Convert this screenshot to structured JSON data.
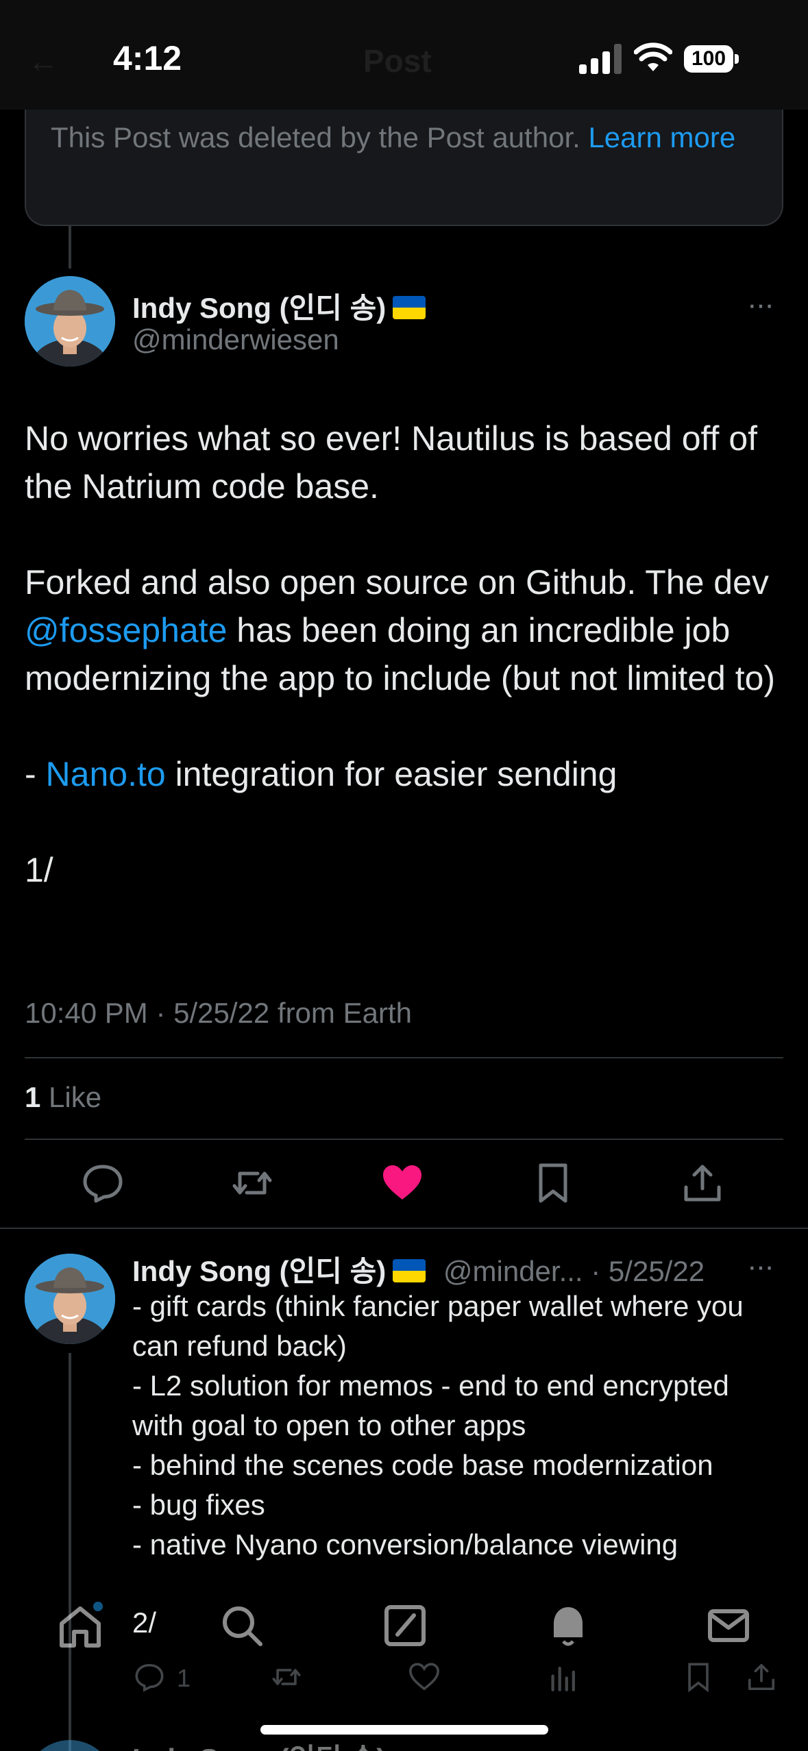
{
  "status_bar": {
    "time": "4:12",
    "battery": "100",
    "ghost_title": "Post",
    "ghost_back": "←"
  },
  "deleted_notice": {
    "text": "This Post was deleted by the Post author. ",
    "link": "Learn more"
  },
  "main_tweet": {
    "author_name": "Indy Song (인디 송)",
    "handle": "@minderwiesen",
    "more": "···",
    "paragraphs": [
      [
        {
          "t": "No worries what so ever! Nautilus is based off of the Natrium code base."
        }
      ],
      [
        {
          "t": "Forked and also open source on Github. The dev "
        },
        {
          "t": "@fossephate",
          "link": true
        },
        {
          "t": " has been doing an incredible job modernizing the app to include (but not limited to)"
        }
      ],
      [
        {
          "t": "- "
        },
        {
          "t": "Nano.to",
          "link": true
        },
        {
          "t": " integration for easier sending"
        }
      ],
      [
        {
          "t": "1/"
        }
      ]
    ],
    "timestamp": "10:40 PM · 5/25/22 from Earth",
    "like_count": "1",
    "like_label": " Like"
  },
  "reply_tweet": {
    "author_name": "Indy Song (인디 송)",
    "handle": "@minder...",
    "date": " · 5/25/22",
    "more": "···",
    "lines": [
      "- gift cards (think fancier paper wallet where you can refund back)",
      "- L2 solution for memos - end to end encrypted with goal to open to other apps",
      "- behind the scenes code base modernization",
      "- bug fixes",
      "- native Nyano conversion/balance viewing"
    ],
    "thread_count": "2/",
    "reply_count": "1"
  },
  "next_preview": {
    "author_name": "Indy Song (인디 송)"
  },
  "colors": {
    "background": "#000000",
    "accent": "#1d9bf0",
    "like": "#f91880",
    "muted": "#71767b",
    "text": "#e7e9ea"
  },
  "icons": [
    "reply-icon",
    "retweet-icon",
    "heart-icon",
    "bookmark-icon",
    "share-icon",
    "home-icon",
    "search-icon",
    "compose-icon",
    "notifications-icon",
    "messages-icon",
    "views-icon"
  ]
}
